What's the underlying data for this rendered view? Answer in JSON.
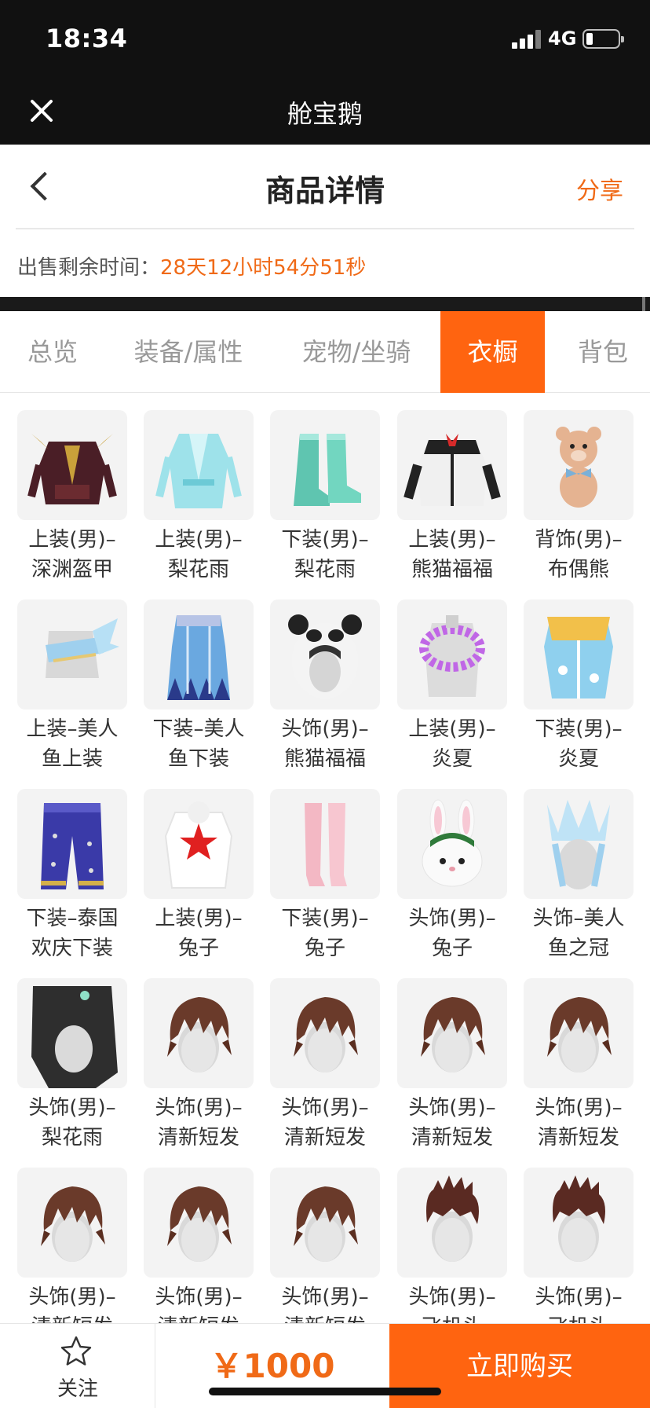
{
  "status": {
    "time": "18:34",
    "network": "4G"
  },
  "app": {
    "title": "舱宝鹅"
  },
  "header": {
    "title": "商品详情",
    "share": "分享"
  },
  "countdown": {
    "label": "出售剩余时间：",
    "value": "28天12小时54分51秒"
  },
  "tabs": [
    {
      "label": "总览",
      "active": false
    },
    {
      "label": "装备/属性",
      "active": false
    },
    {
      "label": "宠物/坐骑",
      "active": false
    },
    {
      "label": "衣橱",
      "active": true
    },
    {
      "label": "背包",
      "active": false
    }
  ],
  "items": [
    {
      "line1": "上装(男)–",
      "line2": "深渊盔甲",
      "icon": "armor"
    },
    {
      "line1": "上装(男)–",
      "line2": "梨花雨",
      "icon": "robe"
    },
    {
      "line1": "下装(男)–",
      "line2": "梨花雨",
      "icon": "boots"
    },
    {
      "line1": "上装(男)–",
      "line2": "熊猫福福",
      "icon": "jacket"
    },
    {
      "line1": "背饰(男)–",
      "line2": "布偶熊",
      "icon": "bear"
    },
    {
      "line1": "上装–美人",
      "line2": "鱼上装",
      "icon": "mermaid-top"
    },
    {
      "line1": "下装–美人",
      "line2": "鱼下装",
      "icon": "mermaid-skirt"
    },
    {
      "line1": "头饰(男)–",
      "line2": "熊猫福福",
      "icon": "panda-hood"
    },
    {
      "line1": "上装(男)–",
      "line2": "炎夏",
      "icon": "lei"
    },
    {
      "line1": "下装(男)–",
      "line2": "炎夏",
      "icon": "shorts"
    },
    {
      "line1": "下装–泰国",
      "line2": "欢庆下装",
      "icon": "pants"
    },
    {
      "line1": "上装(男)–",
      "line2": "兔子",
      "icon": "star-suit"
    },
    {
      "line1": "下装(男)–",
      "line2": "兔子",
      "icon": "legs"
    },
    {
      "line1": "头饰(男)–",
      "line2": "兔子",
      "icon": "bunny"
    },
    {
      "line1": "头饰–美人",
      "line2": "鱼之冠",
      "icon": "crown"
    },
    {
      "line1": "头饰(男)–",
      "line2": "梨花雨",
      "icon": "black-hair"
    },
    {
      "line1": "头饰(男)–",
      "line2": "清新短发",
      "icon": "hair"
    },
    {
      "line1": "头饰(男)–",
      "line2": "清新短发",
      "icon": "hair"
    },
    {
      "line1": "头饰(男)–",
      "line2": "清新短发",
      "icon": "hair"
    },
    {
      "line1": "头饰(男)–",
      "line2": "清新短发",
      "icon": "hair"
    },
    {
      "line1": "头饰(男)–",
      "line2": "清新短发",
      "icon": "hair"
    },
    {
      "line1": "头饰(男)–",
      "line2": "清新短发",
      "icon": "hair"
    },
    {
      "line1": "头饰(男)–",
      "line2": "清新短发",
      "icon": "hair"
    },
    {
      "line1": "头饰(男)–",
      "line2": "飞机头",
      "icon": "spiky-hair"
    },
    {
      "line1": "头饰(男)–",
      "line2": "飞机头",
      "icon": "spiky-hair"
    }
  ],
  "bottom": {
    "follow": "关注",
    "price": "￥1000",
    "buy": "立即购买"
  },
  "colors": {
    "accent": "#ff6410",
    "price": "#f06a17"
  }
}
